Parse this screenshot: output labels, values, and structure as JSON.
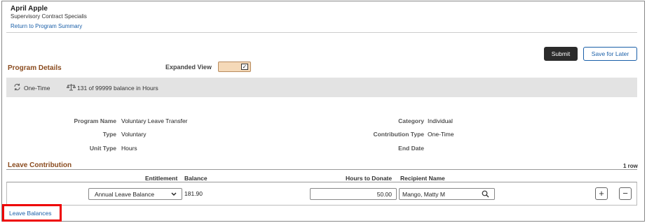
{
  "header": {
    "user_name": "April Apple",
    "user_title": "Supervisory Contract Specialis",
    "return_link": "Return to Program Summary"
  },
  "actions": {
    "submit": "Submit",
    "save_for_later": "Save for Later"
  },
  "program_details": {
    "title": "Program Details",
    "expanded_view_label": "Expanded View",
    "expanded_view_checked": true,
    "check_glyph": "✓",
    "banner": {
      "frequency": "One-Time",
      "balance_text": "131 of 99999 balance in Hours"
    },
    "fields": {
      "program_name_label": "Program Name",
      "program_name": "Voluntary Leave Transfer",
      "type_label": "Type",
      "type": "Voluntary",
      "unit_type_label": "Unit Type",
      "unit_type": "Hours",
      "category_label": "Category",
      "category": "Individual",
      "contribution_type_label": "Contribution Type",
      "contribution_type": "One-Time",
      "end_date_label": "End Date",
      "end_date": ""
    }
  },
  "leave_contribution": {
    "title": "Leave Contribution",
    "row_count": "1 row",
    "columns": {
      "entitlement": "Entitlement",
      "balance": "Balance",
      "hours_to_donate": "Hours to Donate",
      "recipient_name": "Recipient Name"
    },
    "rows": [
      {
        "entitlement": "Annual Leave Balance",
        "balance": "181.90",
        "hours_to_donate": "50.00",
        "recipient_name": "Mango, Matty M"
      }
    ],
    "add_glyph": "+",
    "remove_glyph": "−"
  },
  "footer": {
    "leave_balances_link": "Leave Balances"
  },
  "colors": {
    "section_title": "#8a4b1e",
    "link": "#1a5fa8",
    "highlight": "#e00000",
    "banner_bg": "#e3e3e3"
  }
}
